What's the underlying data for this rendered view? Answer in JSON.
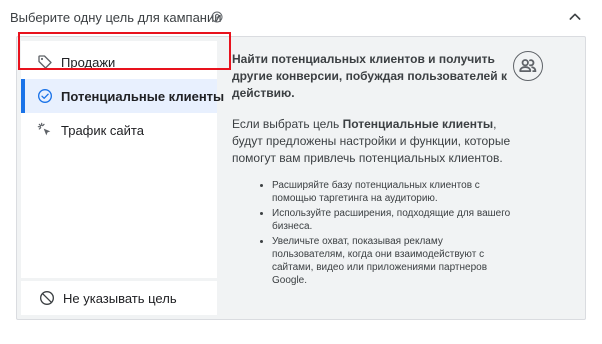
{
  "header": {
    "title": "Выберите одну цель для кампании",
    "help_icon": "help-outline-icon",
    "collapse_icon": "chevron-up-icon"
  },
  "goals": [
    {
      "label": "Продажи",
      "icon": "tag-icon",
      "selected": false
    },
    {
      "label": "Потенциальные клиенты",
      "icon": "check-circle-icon",
      "selected": true
    },
    {
      "label": "Трафик сайта",
      "icon": "cursor-click-icon",
      "selected": false
    }
  ],
  "no_goal": {
    "label": "Не указывать цель",
    "icon": "block-icon"
  },
  "detail": {
    "lead": "Найти потенциальных клиентов и получить другие конверсии, побуждая пользователей к действию.",
    "para_prefix": "Если выбрать цель ",
    "para_bold": "Потенциальные клиенты",
    "para_suffix": ", будут предложены настройки и функции, которые помогут вам привлечь потенциальных клиентов.",
    "bullets": [
      "Расширяйте базу потенциальных клиентов с помощью таргетинга на аудиторию.",
      "Используйте расширения, подходящие для вашего бизнеса.",
      "Увеличьте охват, показывая рекламу пользователям, когда они взаимодействуют с сайтами, видео или приложениями партнеров Google."
    ],
    "icon": "people-icon"
  },
  "colors": {
    "accent": "#1a73e8",
    "highlight": "#e8121d",
    "panel_bg": "#f1f3f4",
    "selected_bg": "#e8f0fe"
  }
}
